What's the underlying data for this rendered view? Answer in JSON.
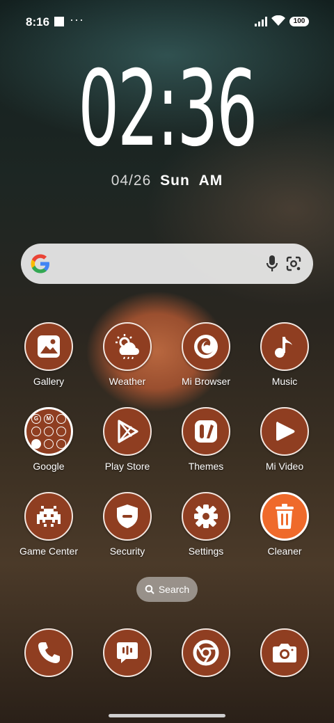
{
  "status_bar": {
    "time": "8:16",
    "dots": "···",
    "battery": "100"
  },
  "clock": {
    "time": "02:36",
    "date": "04/26",
    "day": "Sun",
    "ampm": "AM"
  },
  "apps": [
    {
      "label": "Gallery",
      "icon": "gallery-icon"
    },
    {
      "label": "Weather",
      "icon": "weather-icon"
    },
    {
      "label": "Mi Browser",
      "icon": "browser-icon"
    },
    {
      "label": "Music",
      "icon": "music-icon"
    },
    {
      "label": "Google",
      "icon": "google-folder-icon"
    },
    {
      "label": "Play Store",
      "icon": "play-store-icon"
    },
    {
      "label": "Themes",
      "icon": "themes-icon"
    },
    {
      "label": "Mi Video",
      "icon": "video-icon"
    },
    {
      "label": "Game Center",
      "icon": "game-icon"
    },
    {
      "label": "Security",
      "icon": "shield-icon"
    },
    {
      "label": "Settings",
      "icon": "gear-icon"
    },
    {
      "label": "Cleaner",
      "icon": "trash-icon"
    }
  ],
  "google_folder_letters": [
    "G",
    "M",
    "",
    "",
    "",
    "",
    "",
    "",
    ""
  ],
  "drawer_search": {
    "label": "Search"
  },
  "dock": [
    {
      "icon": "phone-icon"
    },
    {
      "icon": "messages-icon"
    },
    {
      "icon": "chrome-icon"
    },
    {
      "icon": "camera-icon"
    }
  ],
  "colors": {
    "icon_bg": "#8f3e21",
    "cleaner_bg": "#ef6a2b"
  }
}
